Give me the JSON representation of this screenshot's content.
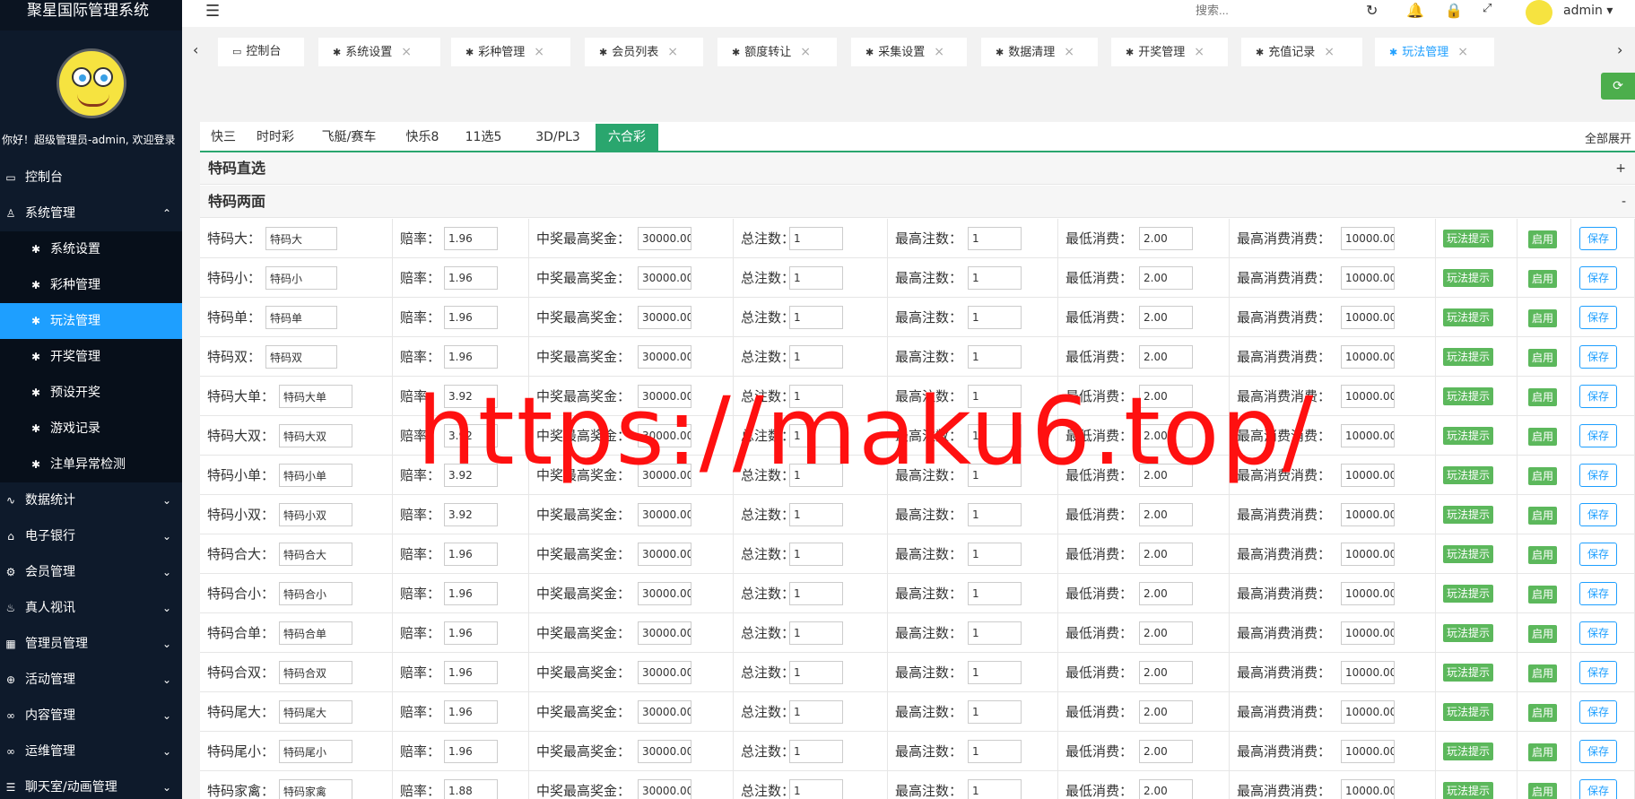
{
  "app": {
    "title": "聚星国际管理系统",
    "greeting": "你好！超级管理员-admin, 欢迎登录"
  },
  "sidebar": {
    "items": [
      {
        "label": "控制台",
        "icon": "monitor-icon",
        "sub": false,
        "active": false,
        "chev": ""
      },
      {
        "label": "系统管理",
        "icon": "user-icon",
        "sub": false,
        "active": false,
        "chev": "⌃"
      },
      {
        "label": "系统设置",
        "icon": "star-icon",
        "sub": true,
        "active": false,
        "chev": ""
      },
      {
        "label": "彩种管理",
        "icon": "star-icon",
        "sub": true,
        "active": false,
        "chev": ""
      },
      {
        "label": "玩法管理",
        "icon": "star-icon",
        "sub": true,
        "active": true,
        "chev": ""
      },
      {
        "label": "开奖管理",
        "icon": "star-icon",
        "sub": true,
        "active": false,
        "chev": ""
      },
      {
        "label": "预设开奖",
        "icon": "star-icon",
        "sub": true,
        "active": false,
        "chev": ""
      },
      {
        "label": "游戏记录",
        "icon": "star-icon",
        "sub": true,
        "active": false,
        "chev": ""
      },
      {
        "label": "注单异常检测",
        "icon": "star-icon",
        "sub": true,
        "active": false,
        "chev": ""
      },
      {
        "label": "数据统计",
        "icon": "pulse-icon",
        "sub": false,
        "active": false,
        "chev": "⌄"
      },
      {
        "label": "电子银行",
        "icon": "bank-icon",
        "sub": false,
        "active": false,
        "chev": "⌄"
      },
      {
        "label": "会员管理",
        "icon": "gear-icon",
        "sub": false,
        "active": false,
        "chev": "⌄"
      },
      {
        "label": "真人视讯",
        "icon": "fire-icon",
        "sub": false,
        "active": false,
        "chev": "⌄"
      },
      {
        "label": "管理员管理",
        "icon": "grid-icon",
        "sub": false,
        "active": false,
        "chev": "⌄"
      },
      {
        "label": "活动管理",
        "icon": "plus-circle-icon",
        "sub": false,
        "active": false,
        "chev": "⌄"
      },
      {
        "label": "内容管理",
        "icon": "infinity-icon",
        "sub": false,
        "active": false,
        "chev": "⌄"
      },
      {
        "label": "运维管理",
        "icon": "infinity-icon",
        "sub": false,
        "active": false,
        "chev": "⌄"
      },
      {
        "label": "聊天室/动画管理",
        "icon": "chat-icon",
        "sub": false,
        "active": false,
        "chev": "⌄"
      }
    ]
  },
  "header": {
    "search_placeholder": "搜索...",
    "user": "admin"
  },
  "tabs": [
    {
      "label": "控制台",
      "closable": false,
      "active": false
    },
    {
      "label": "系统设置",
      "closable": true,
      "active": false
    },
    {
      "label": "彩种管理",
      "closable": true,
      "active": false
    },
    {
      "label": "会员列表",
      "closable": true,
      "active": false
    },
    {
      "label": "额度转让",
      "closable": true,
      "active": false
    },
    {
      "label": "采集设置",
      "closable": true,
      "active": false
    },
    {
      "label": "数据清理",
      "closable": true,
      "active": false
    },
    {
      "label": "开奖管理",
      "closable": true,
      "active": false
    },
    {
      "label": "充值记录",
      "closable": true,
      "active": false
    },
    {
      "label": "玩法管理",
      "closable": true,
      "active": true
    }
  ],
  "lottery_tabs": [
    "快三",
    "时时彩",
    "飞艇/赛车",
    "快乐8",
    "11选5",
    "3D/PL3",
    "六合彩"
  ],
  "active_lottery": "六合彩",
  "expand_all": "全部展开",
  "sections": [
    {
      "title": "特码直选",
      "toggle": "+"
    },
    {
      "title": "特码两面",
      "toggle": "-"
    }
  ],
  "labels": {
    "odds": "赔率：",
    "max_prize": "中奖最高奖金：",
    "total_bets": "总注数：",
    "max_bets": "最高注数：",
    "min_spend": "最低消费：",
    "max_spend": "最高消费消费：",
    "tip_btn": "玩法提示",
    "enable_btn": "启用",
    "save_btn": "保存"
  },
  "rows": [
    {
      "label": "特码大：",
      "name": "特码大",
      "odds": "1.96",
      "max_prize": "30000.00",
      "total": "1",
      "max_bets": "1",
      "min_spend": "2.00",
      "max_spend": "10000.00"
    },
    {
      "label": "特码小：",
      "name": "特码小",
      "odds": "1.96",
      "max_prize": "30000.00",
      "total": "1",
      "max_bets": "1",
      "min_spend": "2.00",
      "max_spend": "10000.00"
    },
    {
      "label": "特码单：",
      "name": "特码单",
      "odds": "1.96",
      "max_prize": "30000.00",
      "total": "1",
      "max_bets": "1",
      "min_spend": "2.00",
      "max_spend": "10000.00"
    },
    {
      "label": "特码双：",
      "name": "特码双",
      "odds": "1.96",
      "max_prize": "30000.00",
      "total": "1",
      "max_bets": "1",
      "min_spend": "2.00",
      "max_spend": "10000.00"
    },
    {
      "label": "特码大单：",
      "name": "特码大单",
      "odds": "3.92",
      "max_prize": "30000.00",
      "total": "1",
      "max_bets": "1",
      "min_spend": "2.00",
      "max_spend": "10000.00"
    },
    {
      "label": "特码大双：",
      "name": "特码大双",
      "odds": "3.92",
      "max_prize": "30000.00",
      "total": "1",
      "max_bets": "1",
      "min_spend": "2.00",
      "max_spend": "10000.00"
    },
    {
      "label": "特码小单：",
      "name": "特码小单",
      "odds": "3.92",
      "max_prize": "30000.00",
      "total": "1",
      "max_bets": "1",
      "min_spend": "2.00",
      "max_spend": "10000.00"
    },
    {
      "label": "特码小双：",
      "name": "特码小双",
      "odds": "3.92",
      "max_prize": "30000.00",
      "total": "1",
      "max_bets": "1",
      "min_spend": "2.00",
      "max_spend": "10000.00"
    },
    {
      "label": "特码合大：",
      "name": "特码合大",
      "odds": "1.96",
      "max_prize": "30000.00",
      "total": "1",
      "max_bets": "1",
      "min_spend": "2.00",
      "max_spend": "10000.00"
    },
    {
      "label": "特码合小：",
      "name": "特码合小",
      "odds": "1.96",
      "max_prize": "30000.00",
      "total": "1",
      "max_bets": "1",
      "min_spend": "2.00",
      "max_spend": "10000.00"
    },
    {
      "label": "特码合单：",
      "name": "特码合单",
      "odds": "1.96",
      "max_prize": "30000.00",
      "total": "1",
      "max_bets": "1",
      "min_spend": "2.00",
      "max_spend": "10000.00"
    },
    {
      "label": "特码合双：",
      "name": "特码合双",
      "odds": "1.96",
      "max_prize": "30000.00",
      "total": "1",
      "max_bets": "1",
      "min_spend": "2.00",
      "max_spend": "10000.00"
    },
    {
      "label": "特码尾大：",
      "name": "特码尾大",
      "odds": "1.96",
      "max_prize": "30000.00",
      "total": "1",
      "max_bets": "1",
      "min_spend": "2.00",
      "max_spend": "10000.00"
    },
    {
      "label": "特码尾小：",
      "name": "特码尾小",
      "odds": "1.96",
      "max_prize": "30000.00",
      "total": "1",
      "max_bets": "1",
      "min_spend": "2.00",
      "max_spend": "10000.00"
    },
    {
      "label": "特码家禽：",
      "name": "特码家禽",
      "odds": "1.88",
      "max_prize": "30000.00",
      "total": "1",
      "max_bets": "1",
      "min_spend": "2.00",
      "max_spend": "10000.00"
    }
  ],
  "watermark": "https://maku6.top/"
}
